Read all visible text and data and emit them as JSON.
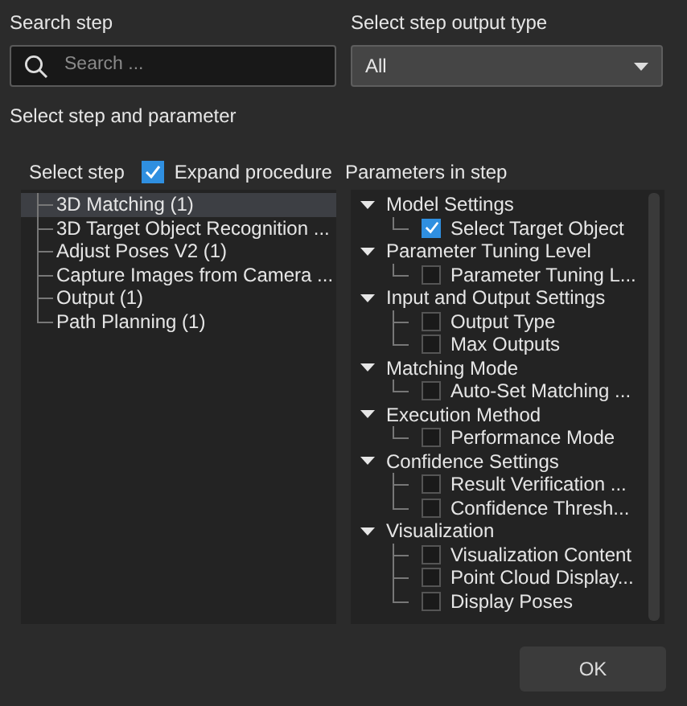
{
  "search_label": "Search step",
  "search": {
    "placeholder": "Search ..."
  },
  "output_type_label": "Select step output type",
  "output_type": {
    "value": "All"
  },
  "section_label": "Select step and parameter",
  "steps_label": "Select step",
  "expand_procedure": {
    "label": "Expand procedure",
    "checked": true
  },
  "params_label": "Parameters in step",
  "steps": [
    {
      "label": "3D Matching (1)",
      "selected": true
    },
    {
      "label": "3D Target Object Recognition ...",
      "selected": false
    },
    {
      "label": "Adjust Poses V2 (1)",
      "selected": false
    },
    {
      "label": "Capture Images from Camera ...",
      "selected": false
    },
    {
      "label": "Output (1)",
      "selected": false
    },
    {
      "label": "Path Planning (1)",
      "selected": false
    }
  ],
  "parameters": [
    {
      "label": "Model Settings",
      "expanded": true,
      "children": [
        {
          "label": "Select Target Object",
          "checked": true
        }
      ]
    },
    {
      "label": "Parameter Tuning Level",
      "expanded": true,
      "children": [
        {
          "label": "Parameter Tuning L...",
          "checked": false
        }
      ]
    },
    {
      "label": "Input and Output Settings",
      "expanded": true,
      "children": [
        {
          "label": "Output Type",
          "checked": false
        },
        {
          "label": "Max Outputs",
          "checked": false
        }
      ]
    },
    {
      "label": "Matching Mode",
      "expanded": true,
      "children": [
        {
          "label": "Auto-Set Matching ...",
          "checked": false
        }
      ]
    },
    {
      "label": "Execution Method",
      "expanded": true,
      "children": [
        {
          "label": "Performance Mode",
          "checked": false
        }
      ]
    },
    {
      "label": "Confidence Settings",
      "expanded": true,
      "children": [
        {
          "label": "Result Verification ...",
          "checked": false
        },
        {
          "label": "Confidence Thresh...",
          "checked": false
        }
      ]
    },
    {
      "label": "Visualization",
      "expanded": true,
      "children": [
        {
          "label": "Visualization Content",
          "checked": false
        },
        {
          "label": "Point Cloud Display...",
          "checked": false
        },
        {
          "label": "Display Poses",
          "checked": false
        }
      ]
    }
  ],
  "ok_button": "OK"
}
